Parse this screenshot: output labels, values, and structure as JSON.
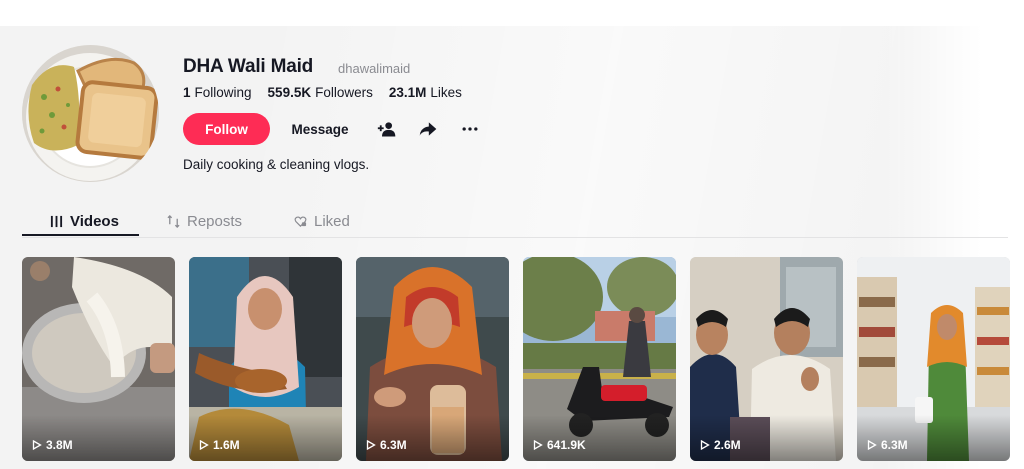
{
  "profile": {
    "name": "DHA Wali Maid",
    "handle": "dhawalimaid",
    "bio": "Daily cooking & cleaning vlogs.",
    "avatar_icon": "toast-omelette-plate",
    "stats": [
      {
        "value": "1",
        "label": "Following"
      },
      {
        "value": "559.5K",
        "label": "Followers"
      },
      {
        "value": "23.1M",
        "label": "Likes"
      }
    ]
  },
  "actions": {
    "follow_label": "Follow",
    "message_label": "Message",
    "icons": [
      "add-friend-icon",
      "share-icon",
      "more-icon"
    ]
  },
  "tabs": [
    {
      "label": "Videos",
      "icon": "grid-icon",
      "active": true
    },
    {
      "label": "Reposts",
      "icon": "repost-icon",
      "active": false
    },
    {
      "label": "Liked",
      "icon": "heart-lock-icon",
      "active": false
    }
  ],
  "videos": [
    {
      "views": "3.8M"
    },
    {
      "views": "1.6M"
    },
    {
      "views": "6.3M"
    },
    {
      "views": "641.9K"
    },
    {
      "views": "2.6M"
    },
    {
      "views": "6.3M"
    }
  ],
  "colors": {
    "accent": "#fe2c55",
    "text": "#161823",
    "muted": "#8a8b91"
  }
}
